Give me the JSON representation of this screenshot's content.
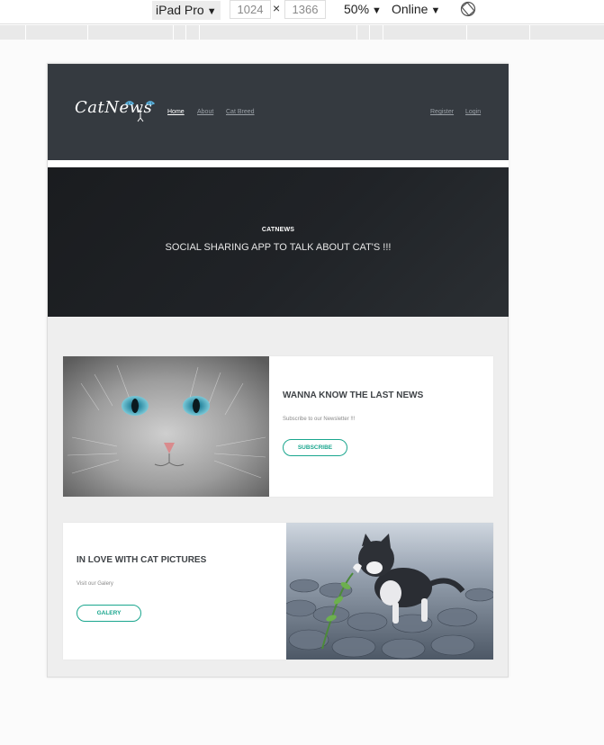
{
  "devtools": {
    "device": "iPad Pro",
    "width": "1024",
    "height": "1366",
    "times": "×",
    "zoom": "50%",
    "network": "Online",
    "rotate_icon": "rotate-icon"
  },
  "navbar": {
    "logo": "CatNews",
    "links": {
      "home": "Home",
      "about": "About",
      "cat_breed": "Cat Breed",
      "register": "Register",
      "login": "Login"
    }
  },
  "hero": {
    "small_title": "CATNEWS",
    "title": "SOCIAL SHARING APP TO TALK ABOUT CAT'S !!!"
  },
  "cards": [
    {
      "title": "WANNA KNOW THE LAST NEWS",
      "text": "Subscribe to our Newsletter !!!",
      "button": "SUBSCRIBE",
      "image": "cat-face-photo"
    },
    {
      "title": "IN LOVE WITH CAT PICTURES",
      "text": "Visit our Galery",
      "button": "GALERY",
      "image": "kitten-playing-photo"
    }
  ],
  "colors": {
    "navbar": "#353a40",
    "hero": "#1f2226",
    "accent": "#1aa68e",
    "page_bg": "#eeeeee"
  }
}
